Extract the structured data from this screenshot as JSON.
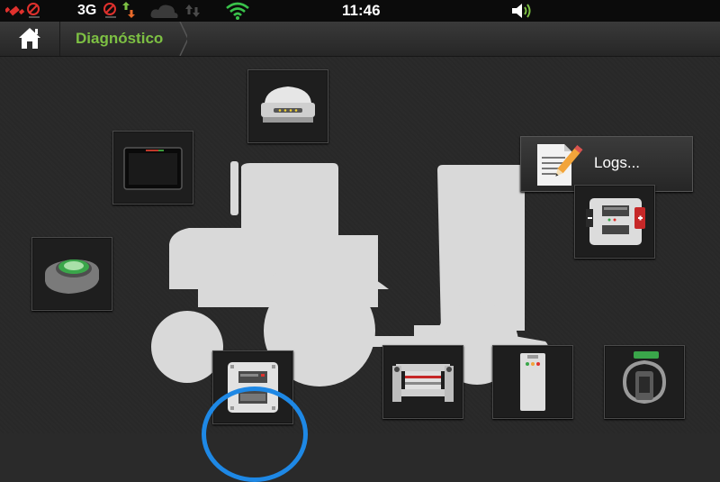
{
  "status_bar": {
    "network_label": "3G",
    "time": "11:46",
    "icons": [
      "gps-disabled-icon",
      "no-signal-icon",
      "data-transfer-icon",
      "cloud-icon",
      "sync-arrows-icon",
      "wifi-icon",
      "volume-icon"
    ]
  },
  "navbar": {
    "home_icon": "home-icon",
    "breadcrumb_label": "Diagnóstico"
  },
  "tiles": {
    "logs_label": "Logs...",
    "items": [
      "gps-receiver-icon",
      "display-monitor-icon",
      "joystick-icon",
      "controller-power-icon",
      "logs-notepad-icon",
      "controller-module-icon",
      "implement-valves-icon",
      "sensor-panel-icon",
      "steering-unit-icon"
    ]
  },
  "colors": {
    "accent_green": "#7dc043",
    "highlight_blue": "#1e88e5",
    "background": "#282828"
  }
}
